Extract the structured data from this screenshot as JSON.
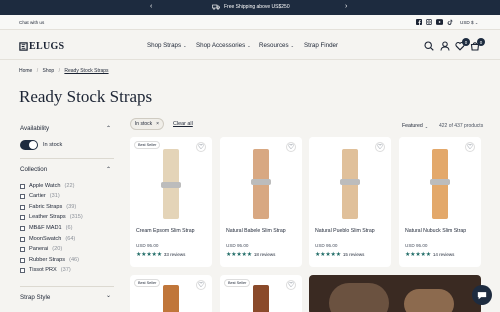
{
  "announcement": {
    "text": "Free Shipping above US$250",
    "prev": "‹",
    "next": "›"
  },
  "subbar": {
    "chat": "Chat with us",
    "currency": "USD $"
  },
  "header": {
    "logo": "ELUGS",
    "nav": [
      {
        "label": "Shop Straps"
      },
      {
        "label": "Shop Accessories"
      },
      {
        "label": "Resources"
      },
      {
        "label": "Strap Finder"
      }
    ],
    "wishlist_count": "0",
    "cart_count": "0"
  },
  "breadcrumb": [
    "Home",
    "Shop",
    "Ready Stock Straps"
  ],
  "page_title": "Ready Stock Straps",
  "sidebar": {
    "availability": {
      "heading": "Availability",
      "toggle_label": "In stock"
    },
    "collection": {
      "heading": "Collection",
      "items": [
        {
          "label": "Apple Watch",
          "count": "(22)"
        },
        {
          "label": "Cartier",
          "count": "(31)"
        },
        {
          "label": "Fabric Straps",
          "count": "(39)"
        },
        {
          "label": "Leather Straps",
          "count": "(315)"
        },
        {
          "label": "MB&F MAD1",
          "count": "(6)"
        },
        {
          "label": "MoonSwatch",
          "count": "(64)"
        },
        {
          "label": "Panerai",
          "count": "(20)"
        },
        {
          "label": "Rubber Straps",
          "count": "(46)"
        },
        {
          "label": "Tissot PRX",
          "count": "(37)"
        }
      ]
    },
    "strap_style": {
      "heading": "Strap Style"
    }
  },
  "toolbar": {
    "chip": "In stock",
    "chip_close": "×",
    "clear": "Clear all",
    "sort": "Featured",
    "count": "422 of 437 products"
  },
  "products": [
    {
      "badge": "Best Seller",
      "name": "Cream Epsom Slim Strap",
      "price": "USD 95.00",
      "stars": "★★★★★",
      "reviews": "33 reviews",
      "color": "#e4d4b8"
    },
    {
      "badge": "",
      "name": "Natural Babele Slim Strap",
      "price": "USD 95.00",
      "stars": "★★★★★",
      "reviews": "18 reviews",
      "color": "#d8a882"
    },
    {
      "badge": "",
      "name": "Natural Pueblo Slim Strap",
      "price": "USD 95.00",
      "stars": "★★★★★",
      "reviews": "15 reviews",
      "color": "#e0c09a"
    },
    {
      "badge": "",
      "name": "Natural Nubuck Slim Strap",
      "price": "USD 95.00",
      "stars": "★★★★★",
      "reviews": "14 reviews",
      "color": "#e3a86a"
    }
  ],
  "products_row2": [
    {
      "badge": "Best Seller",
      "color": "#c0763a"
    },
    {
      "badge": "Best Seller",
      "color": "#8a4a2a"
    }
  ],
  "icons": {
    "chevron_up": "⌃",
    "chevron_down": "⌄",
    "heart": "♡",
    "search": "⌕",
    "chat": "💬"
  }
}
